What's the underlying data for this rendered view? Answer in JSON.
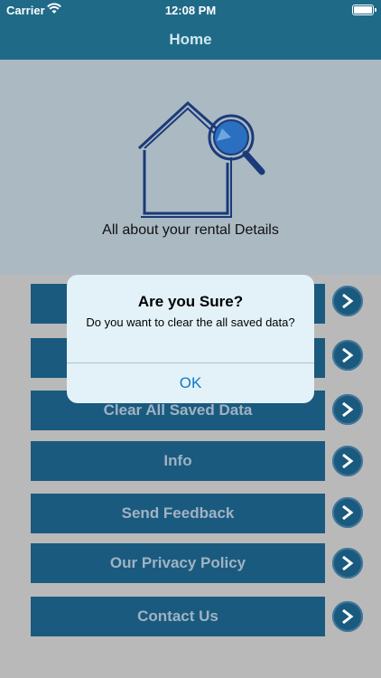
{
  "status_bar": {
    "carrier": "Carrier",
    "time": "12:08 PM"
  },
  "navbar": {
    "title": "Home"
  },
  "hero": {
    "subtitle": "All about your rental Details",
    "icon": "house-search-icon"
  },
  "menu": [
    {
      "label": ""
    },
    {
      "label": ""
    },
    {
      "label": "Clear All Saved Data"
    },
    {
      "label": "Info"
    },
    {
      "label": "Send Feedback"
    },
    {
      "label": "Our Privacy Policy"
    },
    {
      "label": "Contact Us"
    }
  ],
  "alert": {
    "title": "Are you  Sure?",
    "message": "Do you want to clear the all saved data?",
    "ok_label": "OK"
  },
  "colors": {
    "nav": "#1f6a87",
    "button": "#1b5a7f",
    "alert_bg": "#e3f2f8",
    "ok_text": "#1378c9"
  }
}
